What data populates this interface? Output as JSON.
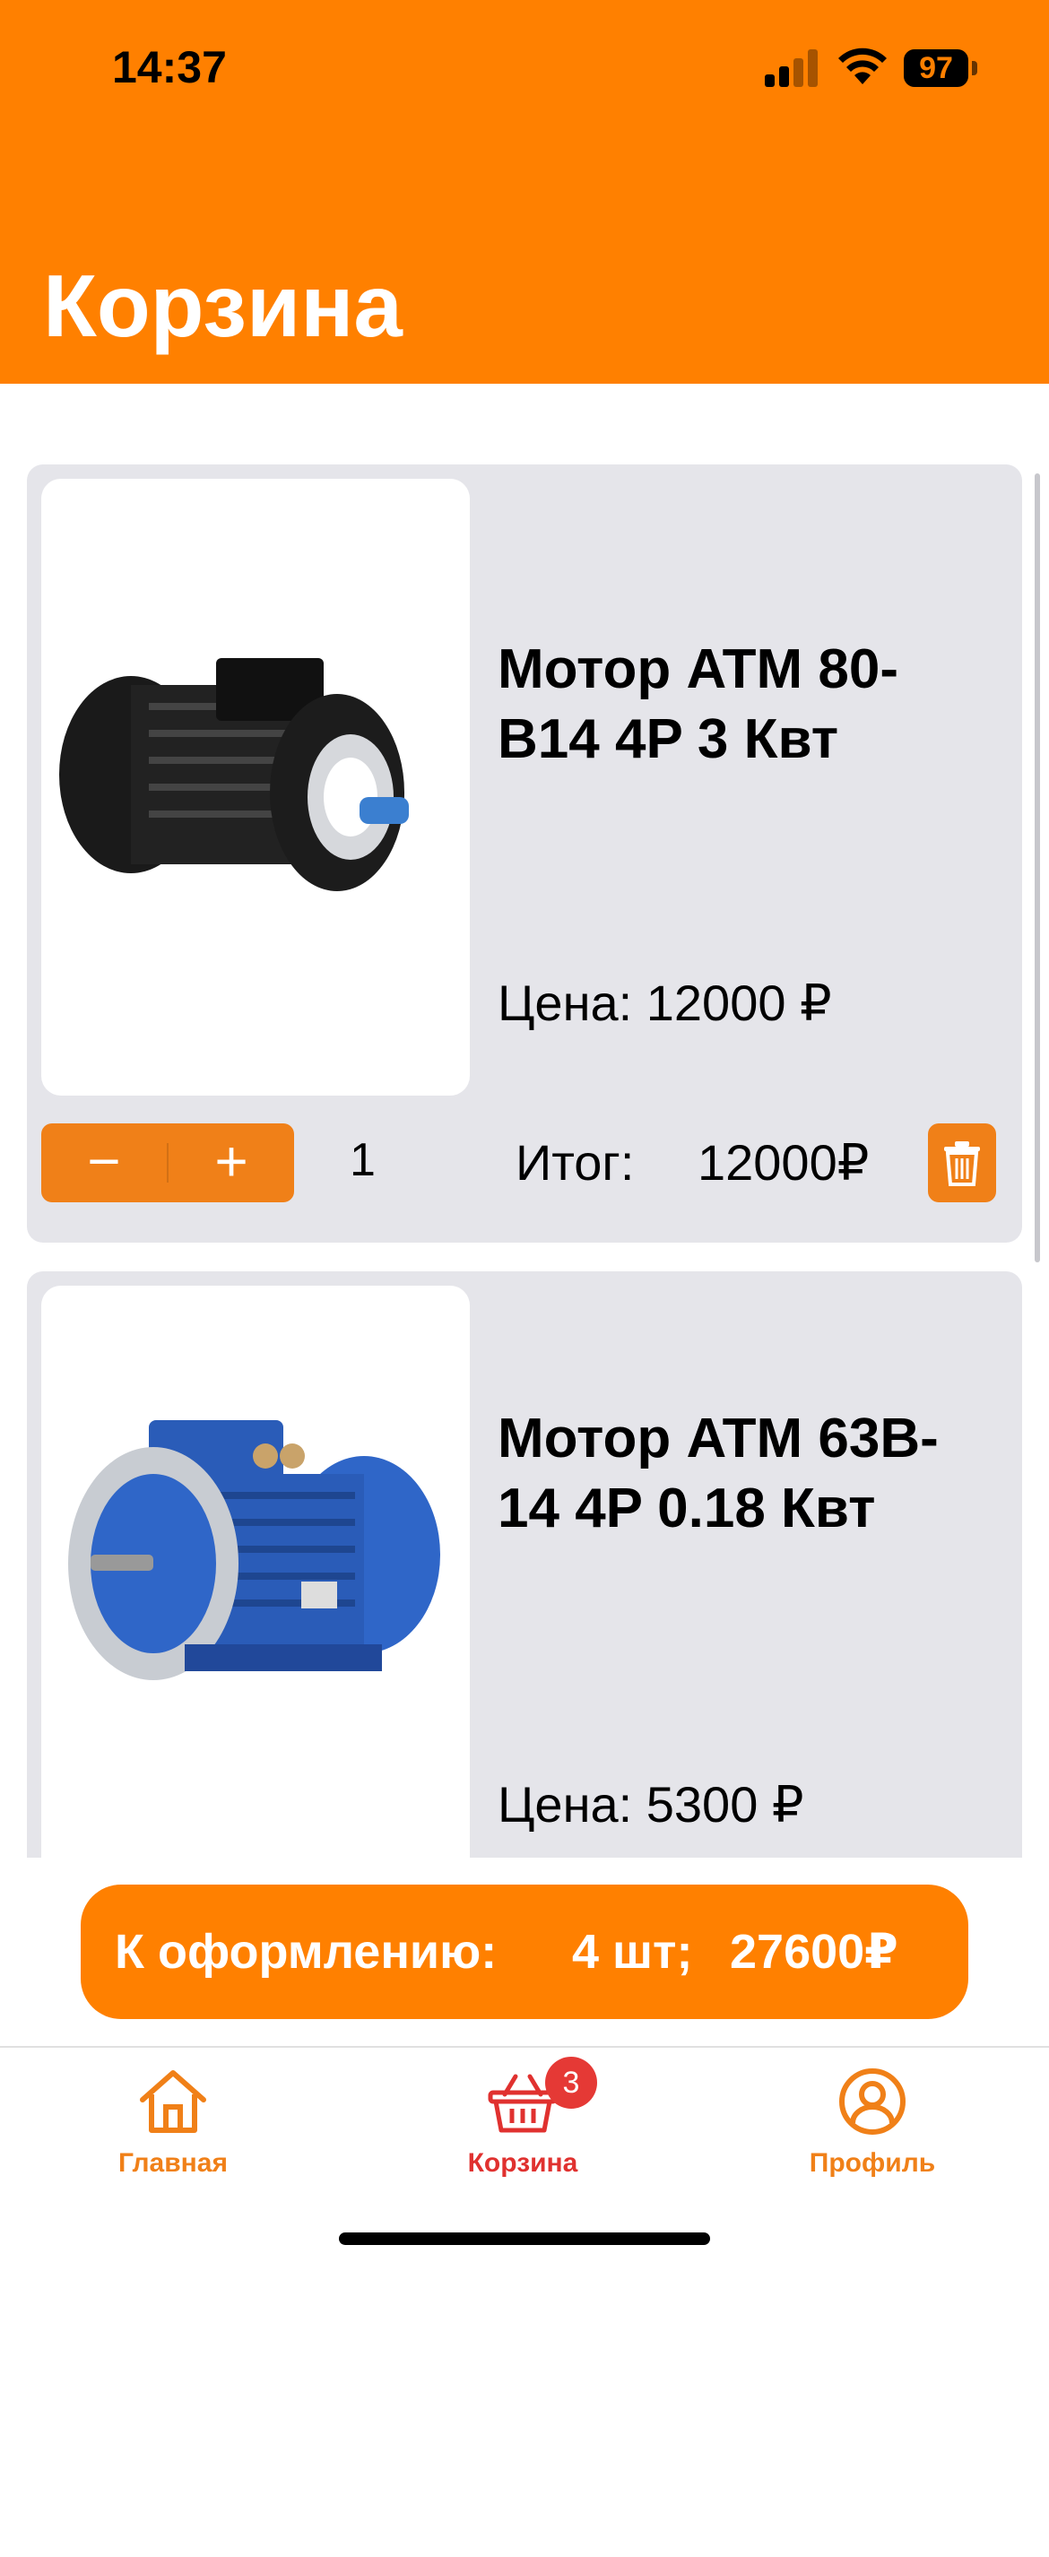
{
  "status_bar": {
    "time": "14:37",
    "battery": "97"
  },
  "header": {
    "title": "Корзина"
  },
  "cart_items": [
    {
      "name": "Мотор ATM 80-B14 4P 3 Квт",
      "price": "Цена: 12000 ₽",
      "quantity": "1",
      "total_label": "Итог:",
      "total_value": "12000₽",
      "image_icon": "motor-black-image"
    },
    {
      "name": "Мотор ATM 63B-14 4P 0.18 Квт",
      "price": "Цена: 5300 ₽",
      "image_icon": "motor-blue-image"
    }
  ],
  "stepper": {
    "minus": "−",
    "plus": "+"
  },
  "checkout": {
    "label": "К оформлению:",
    "count": "4 шт;",
    "sum": "27600₽"
  },
  "tabbar": {
    "items": [
      {
        "label": "Главная",
        "icon": "home-icon"
      },
      {
        "label": "Корзина",
        "icon": "basket-icon",
        "badge": "3"
      },
      {
        "label": "Профиль",
        "icon": "profile-icon"
      }
    ]
  },
  "colors": {
    "accent": "#FF8000",
    "card_bg": "#E5E5EA",
    "badge": "#E53935"
  }
}
